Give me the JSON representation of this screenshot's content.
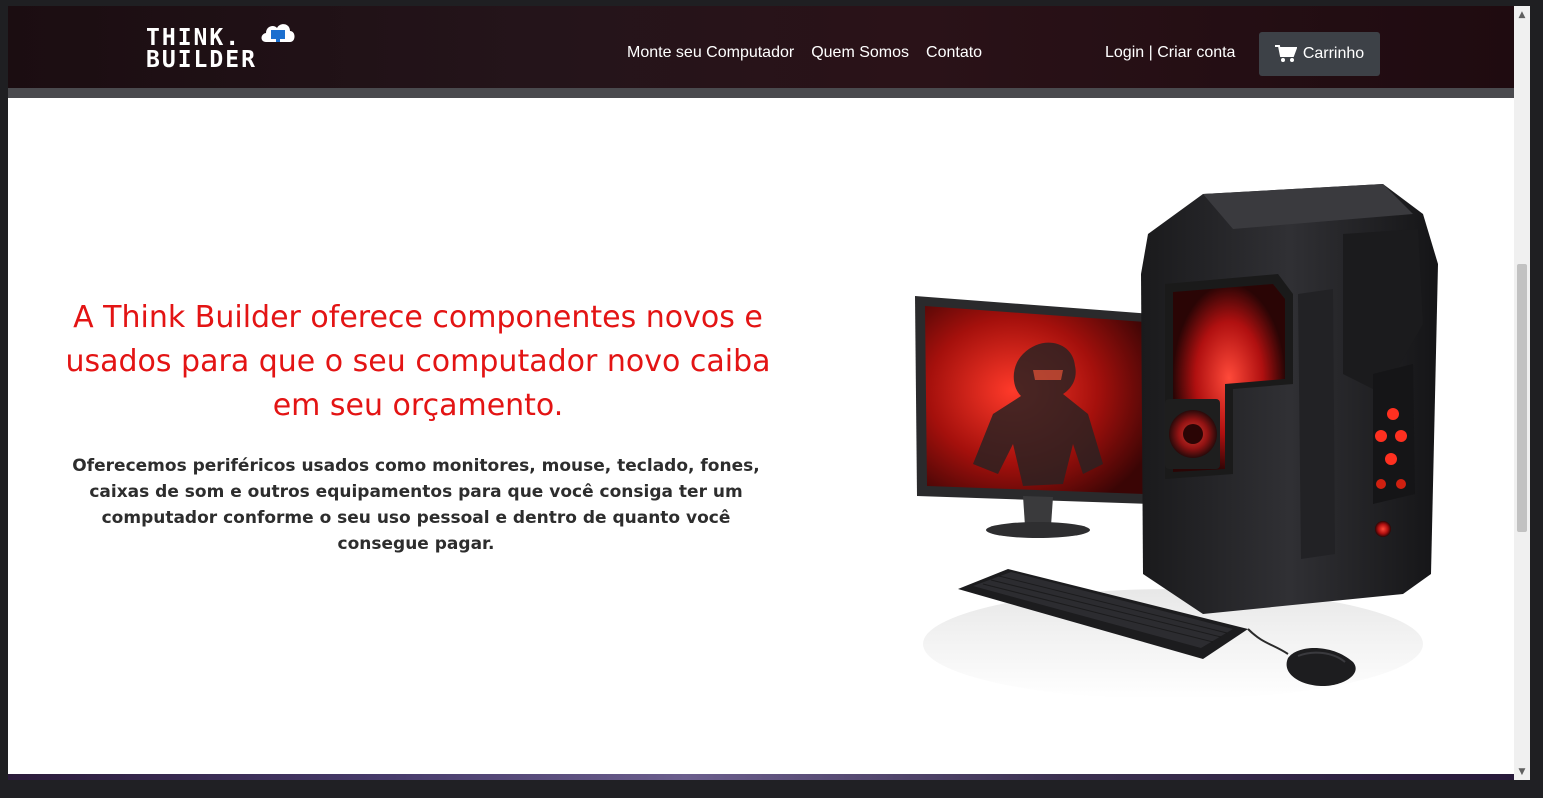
{
  "logo": {
    "line1": "THINK.",
    "line2": "BUILDER",
    "icon": "monitor-cloud-icon"
  },
  "nav": {
    "links": [
      "Monte seu Computador",
      "Quem Somos",
      "Contato"
    ],
    "login": "Login",
    "separator": " | ",
    "signup": "Criar conta",
    "cart": "Carrinho",
    "cart_icon": "cart-icon"
  },
  "hero": {
    "title": "A Think Builder oferece componentes novos e usados para que o seu computador novo caiba em seu orçamento.",
    "text": "Oferecemos periféricos usados como monitores, mouse, teclado, fones, caixas de som e outros equipamentos para que você consiga ter um computador conforme o seu uso pessoal e dentro de quanto você consegue pagar.",
    "image": "gaming-pc-setup-image"
  },
  "colors": {
    "accent": "#e31414",
    "navbar": "#1b0d11",
    "cart_button": "#3d4147"
  }
}
